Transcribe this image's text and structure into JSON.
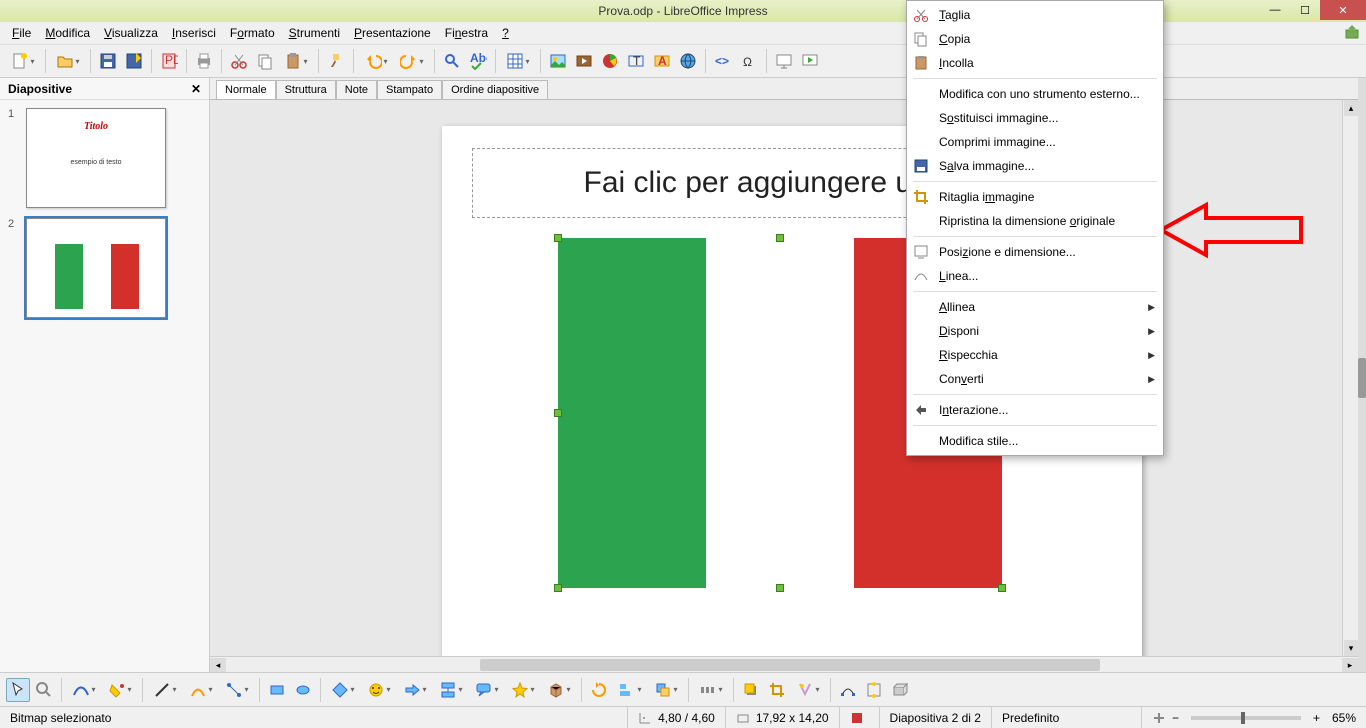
{
  "window": {
    "title": "Prova.odp - LibreOffice Impress"
  },
  "menus": [
    "File",
    "Modifica",
    "Visualizza",
    "Inserisci",
    "Formato",
    "Strumenti",
    "Presentazione",
    "Finestra",
    "?"
  ],
  "menu_accel": [
    0,
    0,
    0,
    0,
    1,
    0,
    0,
    2,
    0
  ],
  "panel": {
    "title": "Diapositive"
  },
  "thumbs": {
    "s1": {
      "num": "1",
      "title": "Titolo",
      "sub": "esempio di testo"
    },
    "s2": {
      "num": "2"
    }
  },
  "viewtabs": [
    "Normale",
    "Struttura",
    "Note",
    "Stampato",
    "Ordine diapositive"
  ],
  "slide": {
    "title_placeholder": "Fai clic per aggiungere un titolo"
  },
  "context": {
    "cut": "Taglia",
    "copy": "Copia",
    "paste": "Incolla",
    "editext": "Modifica con uno strumento esterno...",
    "replace": "Sostituisci immagine...",
    "compress": "Comprimi immagine...",
    "save": "Salva immagine...",
    "crop": "Ritaglia immagine",
    "origsize": "Ripristina la dimensione originale",
    "posdim": "Posizione e dimensione...",
    "line": "Linea...",
    "align": "Allinea",
    "arrange": "Disponi",
    "mirror": "Rispecchia",
    "convert": "Converti",
    "interact": "Interazione...",
    "editstyle": "Modifica stile..."
  },
  "status": {
    "sel": "Bitmap selezionato",
    "pos": "4,80 / 4,60",
    "size": "17,92 x 14,20",
    "slide": "Diapositiva 2 di 2",
    "layout": "Predefinito",
    "zoom": "65%"
  }
}
